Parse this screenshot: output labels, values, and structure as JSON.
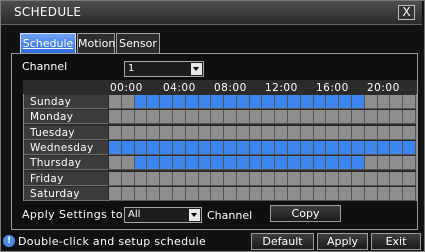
{
  "window": {
    "title": "SCHEDULE",
    "close_label": "X"
  },
  "tabs": [
    {
      "label": "Schedule",
      "active": true
    },
    {
      "label": "Motion",
      "active": false
    },
    {
      "label": "Sensor",
      "active": false
    }
  ],
  "channel": {
    "label": "Channel",
    "value": "1"
  },
  "hour_labels": [
    "00:00",
    "04:00",
    "08:00",
    "12:00",
    "16:00",
    "20:00"
  ],
  "days": [
    {
      "name": "Sunday",
      "active_slots": [
        2,
        3,
        4,
        5,
        6,
        7,
        8,
        9,
        10,
        11,
        12,
        13,
        14,
        15,
        16,
        17,
        18,
        19
      ]
    },
    {
      "name": "Monday",
      "active_slots": []
    },
    {
      "name": "Tuesday",
      "active_slots": []
    },
    {
      "name": "Wednesday",
      "active_slots": [
        0,
        1,
        2,
        3,
        4,
        5,
        6,
        7,
        8,
        9,
        10,
        11,
        12,
        13,
        14,
        15,
        16,
        17,
        18,
        19,
        20,
        21,
        22,
        23
      ]
    },
    {
      "name": "Thursday",
      "active_slots": [
        2,
        3,
        4,
        5,
        6,
        7,
        8,
        9,
        10,
        11,
        12,
        13,
        14,
        15,
        16,
        17,
        18,
        19
      ]
    },
    {
      "name": "Friday",
      "active_slots": []
    },
    {
      "name": "Saturday",
      "active_slots": []
    }
  ],
  "apply": {
    "label": "Apply Settings to",
    "value": "All",
    "channel_label": "Channel",
    "copy_label": "Copy"
  },
  "footer": {
    "hint": "Double-click and setup schedule",
    "default_label": "Default",
    "apply_label": "Apply",
    "exit_label": "Exit"
  },
  "colors": {
    "selected": "#3e86ef",
    "unselected": "#8e8e8e",
    "tab_active": "#3e7ee6"
  }
}
